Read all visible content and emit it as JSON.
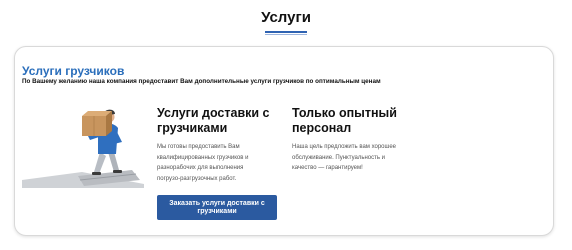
{
  "page": {
    "title": "Услуги"
  },
  "section": {
    "title": "Услуги грузчиков",
    "subtitle": "По Вашему желанию наша компания предоставит Вам дополнительные услуги грузчиков по оптимальным ценам"
  },
  "columns": [
    {
      "heading_line1": "Услуги доставки с",
      "heading_line2": "грузчиками",
      "text_lines": [
        "Мы готовы предоставить Вам",
        "квалифицированных грузчиков и",
        "разнорабочих для выполнения",
        "погрузо-разгрузочных работ."
      ]
    },
    {
      "heading_line1": "Только опытный",
      "heading_line2": "персонал",
      "text_lines": [
        "Наша цель предложить вам хорошее",
        "обслуживание. Пунктуальность и",
        "качество — гарантируем!"
      ]
    }
  ],
  "button": {
    "line1": "Заказать услуги доставки с",
    "line2": "грузчиками"
  },
  "colors": {
    "accent": "#2a6ebb",
    "button": "#2b5aa0"
  }
}
